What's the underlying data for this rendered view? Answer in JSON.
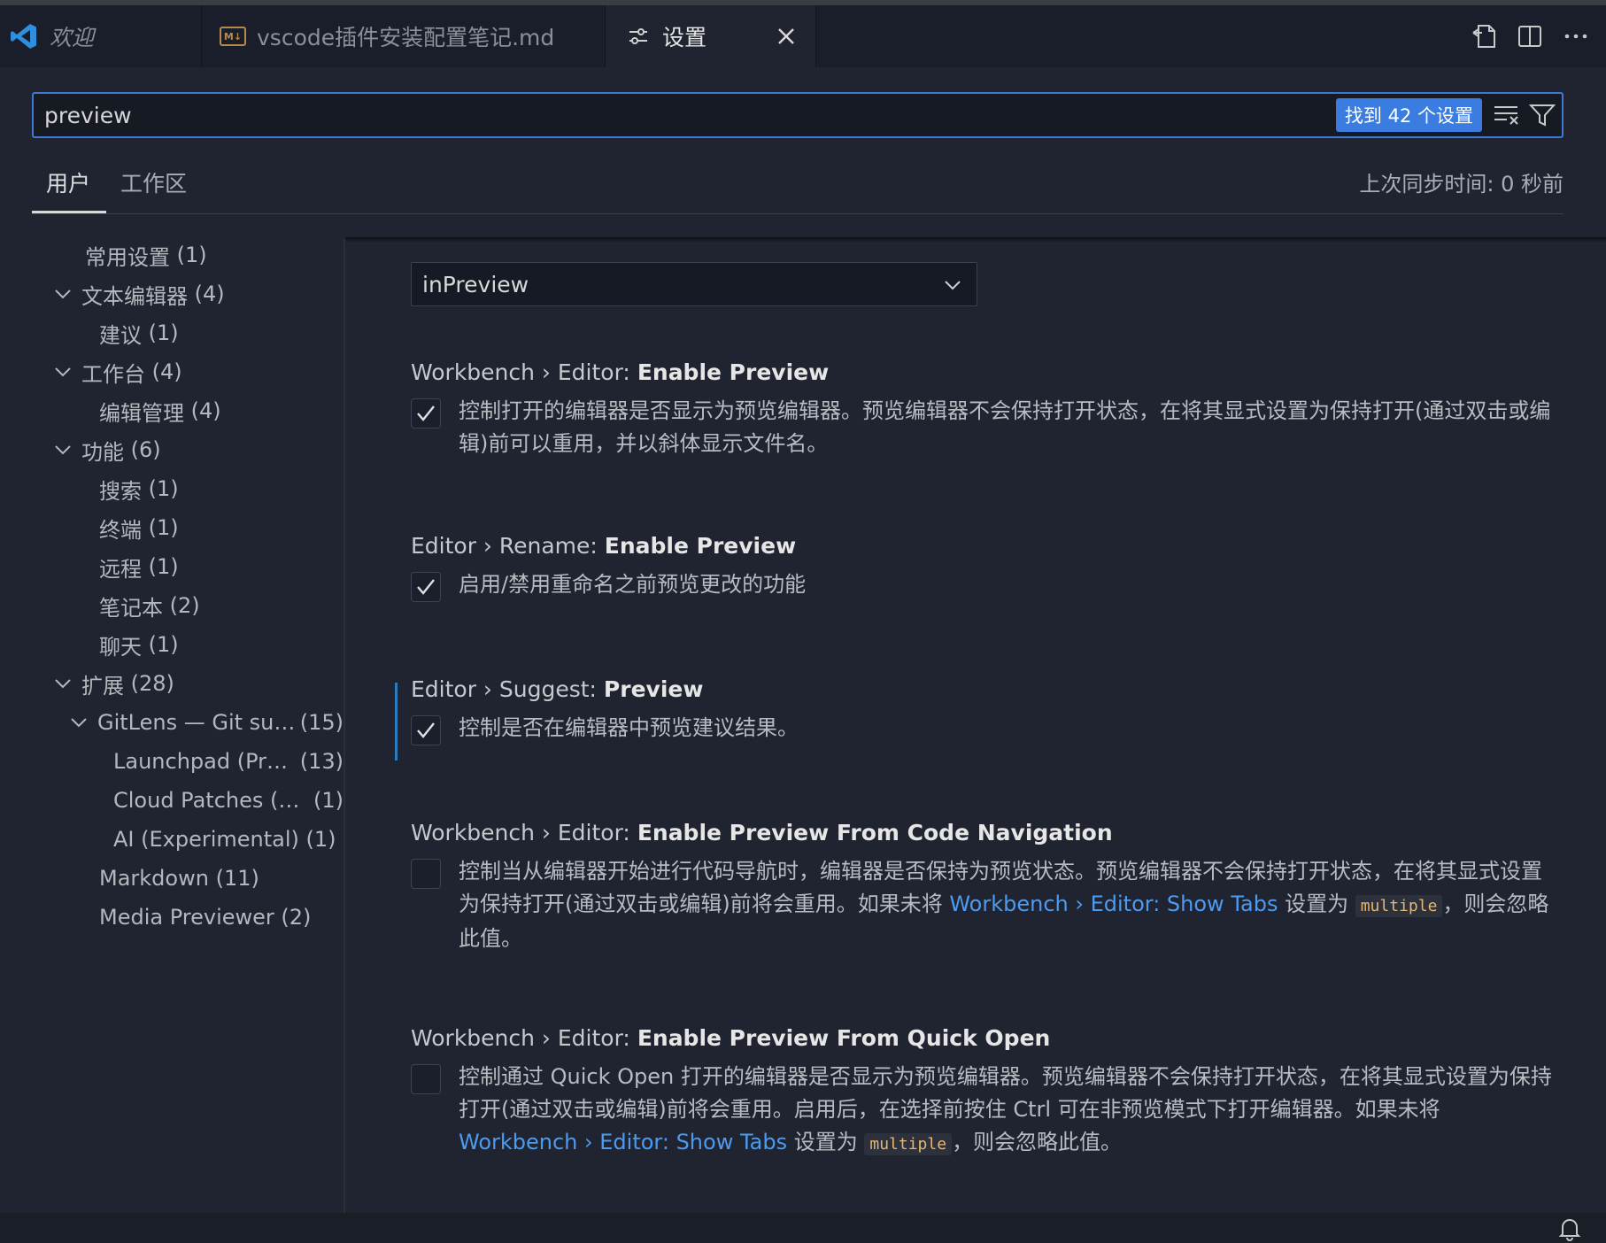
{
  "tabs": {
    "welcome": "欢迎",
    "markdown_file": "vscode插件安装配置笔记.md",
    "markdown_badge": "M↓",
    "settings": "设置"
  },
  "search": {
    "value": "preview",
    "result_count": "找到 42 个设置"
  },
  "scope": {
    "user": "用户",
    "workspace": "工作区",
    "sync_status": "上次同步时间: 0 秒前"
  },
  "tree": [
    {
      "label": "常用设置",
      "count": "(1)"
    },
    {
      "label": "文本编辑器",
      "count": "(4)"
    },
    {
      "label": "建议",
      "count": "(1)"
    },
    {
      "label": "工作台",
      "count": "(4)"
    },
    {
      "label": "编辑管理",
      "count": "(4)"
    },
    {
      "label": "功能",
      "count": "(6)"
    },
    {
      "label": "搜索",
      "count": "(1)"
    },
    {
      "label": "终端",
      "count": "(1)"
    },
    {
      "label": "远程",
      "count": "(1)"
    },
    {
      "label": "笔记本",
      "count": "(2)"
    },
    {
      "label": "聊天",
      "count": "(1)"
    },
    {
      "label": "扩展",
      "count": "(28)"
    },
    {
      "label": "GitLens — Git su…",
      "count": "(15)"
    },
    {
      "label": "Launchpad (Pr…",
      "count": "(13)"
    },
    {
      "label": "Cloud Patches (…",
      "count": "(1)"
    },
    {
      "label": "AI (Experimental)",
      "count": "(1)"
    },
    {
      "label": "Markdown",
      "count": "(11)"
    },
    {
      "label": "Media Previewer",
      "count": "(2)"
    }
  ],
  "dropdown": {
    "value": "inPreview"
  },
  "settings": [
    {
      "prefix": "Workbench › Editor: ",
      "name": "Enable Preview",
      "checked": true,
      "desc": "控制打开的编辑器是否显示为预览编辑器。预览编辑器不会保持打开状态，在将其显式设置为保持打开(通过双击或编辑)前可以重用，并以斜体显示文件名。"
    },
    {
      "prefix": "Editor › Rename: ",
      "name": "Enable Preview",
      "checked": true,
      "desc": "启用/禁用重命名之前预览更改的功能"
    },
    {
      "prefix": "Editor › Suggest: ",
      "name": "Preview",
      "checked": true,
      "desc": "控制是否在编辑器中预览建议结果。"
    },
    {
      "prefix": "Workbench › Editor: ",
      "name": "Enable Preview From Code Navigation",
      "checked": false,
      "desc_a": "控制当从编辑器开始进行代码导航时，编辑器是否保持为预览状态。预览编辑器不会保持打开状态，在将其显式设置为保持打开(通过双击或编辑)前将会重用。如果未将 ",
      "link": "Workbench › Editor: Show Tabs",
      "desc_b": " 设置为 ",
      "code": "multiple",
      "desc_c": "，则会忽略此值。"
    },
    {
      "prefix": "Workbench › Editor: ",
      "name": "Enable Preview From Quick Open",
      "checked": false,
      "desc_a": "控制通过 Quick Open 打开的编辑器是否显示为预览编辑器。预览编辑器不会保持打开状态，在将其显式设置为保持打开(通过双击或编辑)前将会重用。启用后，在选择前按住 Ctrl 可在非预览模式下打开编辑器。如果未将 ",
      "link": "Workbench › Editor: Show Tabs",
      "desc_b": " 设置为 ",
      "code": "multiple",
      "desc_c": "，则会忽略此值。"
    }
  ],
  "icons": {
    "vscode_logo": "vscode-logo-icon",
    "settings_tab": "settings-sliders-icon",
    "close": "close-icon",
    "open_json": "open-settings-json-icon",
    "split": "split-editor-icon",
    "more": "more-actions-icon",
    "clear_filter": "clear-search-icon",
    "filter": "filter-icon",
    "chevron": "chevron-down-icon",
    "check": "check-icon",
    "bell": "bell-icon"
  },
  "colors": {
    "accent": "#3a7ce0",
    "link": "#4c9bf0",
    "background": "#1f2430"
  }
}
